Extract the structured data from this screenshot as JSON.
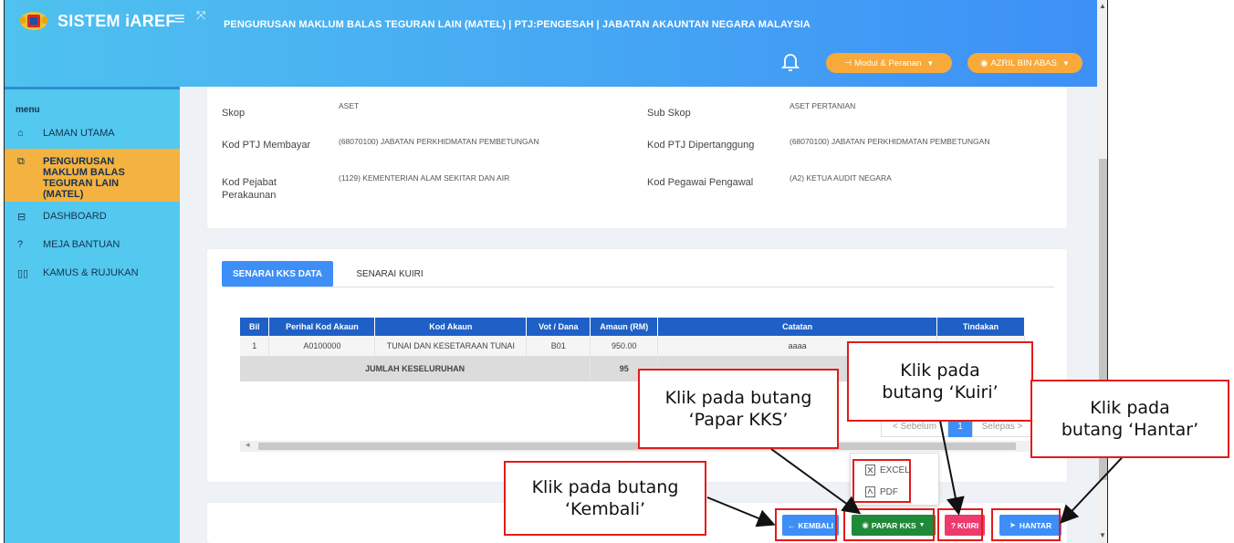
{
  "app": {
    "title": "SISTEM iAREF",
    "menu_icon": "hamburger-icon",
    "expand_icon": "expand-icon",
    "page_header": "PENGURUSAN MAKLUM BALAS TEGURAN LAIN (MATEL) | PTJ:PENGESAH | JABATAN AKAUNTAN NEGARA MALAYSIA",
    "colors": {
      "topbar_start": "#4fc2ef",
      "topbar_end": "#3d8ff7",
      "accent": "#f8a93a",
      "sidebar": "#53c9ef",
      "active": "#f4b240"
    }
  },
  "header": {
    "modul_label": "Modul & Peranan",
    "user_label": "AZRIL BIN ABAS"
  },
  "sidebar": {
    "heading": "menu",
    "items": [
      {
        "label": "LAMAN UTAMA",
        "icon": "home-icon"
      },
      {
        "label": "PENGURUSAN MAKLUM BALAS TEGURAN LAIN (MATEL)",
        "icon": "copy-icon",
        "active": true
      },
      {
        "label": "DASHBOARD",
        "icon": "dashboard-icon"
      },
      {
        "label": "MEJA BANTUAN",
        "icon": "question-icon"
      },
      {
        "label": "KAMUS & RUJUKAN",
        "icon": "book-icon"
      }
    ]
  },
  "info": {
    "skop_label": "Skop",
    "skop_value": "ASET",
    "subskop_label": "Sub Skop",
    "subskop_value": "ASET PERTANIAN",
    "ptj_bayar_label": "Kod PTJ Membayar",
    "ptj_bayar_value": "(68070100) JABATAN PERKHIDMATAN PEMBETUNGAN",
    "ptj_tanggung_label": "Kod PTJ Dipertanggung",
    "ptj_tanggung_value": "(68070100) JABATAN PERKHIDMATAN PEMBETUNGAN",
    "pejabat_label_1": "Kod Pejabat",
    "pejabat_label_2": "Perakaunan",
    "pejabat_value": "(1129) KEMENTERIAN ALAM SEKITAR DAN AIR",
    "pegawai_label": "Kod Pegawai Pengawal",
    "pegawai_value": "(A2) KETUA AUDIT NEGARA"
  },
  "tabs": {
    "kks": "SENARAI KKS DATA",
    "kuiri": "SENARAI KUIRI"
  },
  "table": {
    "headers": [
      "Bil",
      "Perihal Kod Akaun",
      "Kod Akaun",
      "Vot / Dana",
      "Amaun (RM)",
      "Catatan",
      "Tindakan"
    ],
    "rows": [
      [
        "1",
        "A0100000",
        "TUNAI DAN KESETARAAN TUNAI",
        "B01",
        "950.00",
        "aaaa",
        ""
      ]
    ],
    "total_label": "JUMLAH KESELURUHAN",
    "total_value": "95"
  },
  "pager": {
    "prev": "< Sebelum",
    "page": "1",
    "next": "Selepas >"
  },
  "dropdown": {
    "excel": "EXCEL",
    "pdf": "PDF"
  },
  "actions": {
    "kembali": "KEMBALI",
    "papar": "PAPAR KKS",
    "kuiri": "KUIRI",
    "hantar": "HANTAR"
  },
  "callouts": {
    "papar_1": "Klik pada butang",
    "papar_2": "‘Papar KKS’",
    "kuiri_1": "Klik pada",
    "kuiri_2": "butang ‘Kuiri’",
    "hantar_1": "Klik pada",
    "hantar_2": "butang ‘Hantar’",
    "kembali_1": "Klik pada butang",
    "kembali_2": "‘Kembali’"
  }
}
